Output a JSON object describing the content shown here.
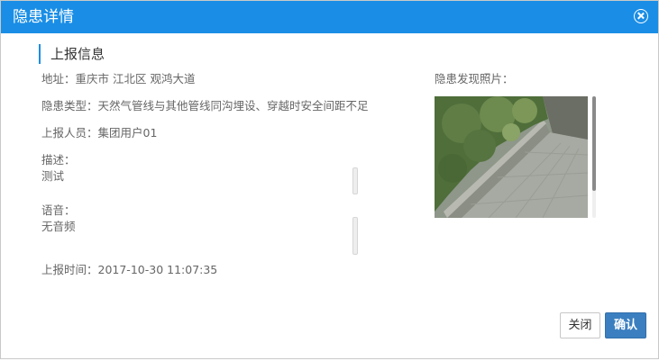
{
  "dialog": {
    "title": "隐患详情"
  },
  "section": {
    "title": "上报信息"
  },
  "fields": {
    "address": "地址：重庆市 江北区 观鸿大道",
    "hazard_type": "隐患类型：天然气管线与其他管线同沟埋设、穿越时安全间距不足",
    "reporter": "上报人员：集团用户01",
    "description_label": "描述：",
    "description_value": "测试",
    "voice_label": "语音：",
    "voice_value": "无音频",
    "report_time": "上报时间：2017-10-30 11:07:35"
  },
  "photo": {
    "label": "隐患发现照片："
  },
  "buttons": {
    "close": "关闭",
    "confirm": "确认"
  },
  "colors": {
    "titlebar": "#1a8ee6",
    "confirm_button": "#3b7fc0"
  },
  "icons": {
    "close": "close-circle-icon"
  }
}
